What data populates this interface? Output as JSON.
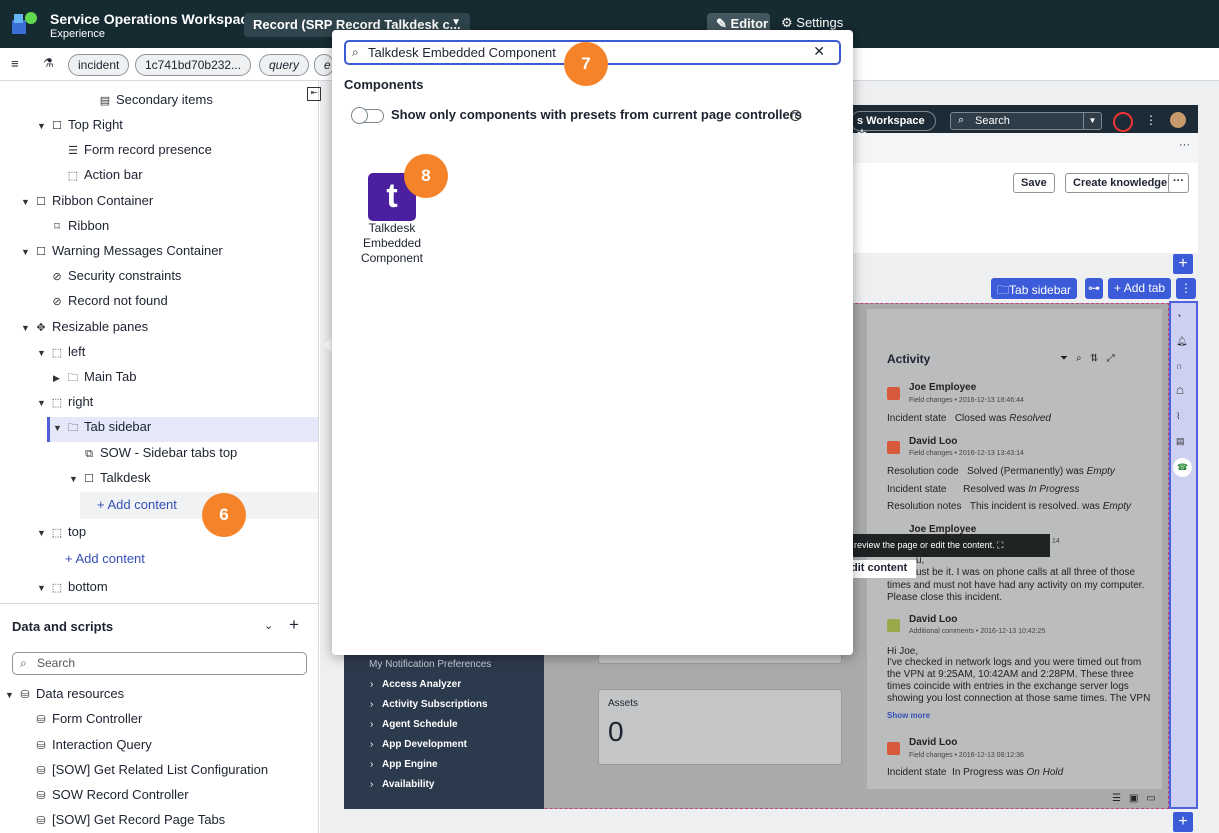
{
  "app": {
    "title": "Service Operations Workspace",
    "subtitle": "Experience"
  },
  "page_selector": {
    "label": "Record (SRP Record Talkdesk c...",
    "chevron": "chevron-down"
  },
  "mode": {
    "editor_label": "Editor",
    "settings_label": "Settings"
  },
  "filter_chips": [
    "incident",
    "1c741bd70b232...",
    "query",
    "e"
  ],
  "tree": {
    "secondary_items": "Secondary items",
    "top_right": "Top Right",
    "form_record_presence": "Form record presence",
    "action_bar": "Action bar",
    "ribbon_container": "Ribbon Container",
    "ribbon": "Ribbon",
    "warning_container": "Warning Messages Container",
    "security_constraints": "Security constraints",
    "record_not_found": "Record not found",
    "resizable_panes": "Resizable panes",
    "left": "left",
    "main_tab": "Main Tab",
    "right": "right",
    "tab_sidebar": "Tab sidebar",
    "sow_sidebar_tabs": "SOW - Sidebar tabs top",
    "talkdesk": "Talkdesk",
    "add_content_1": "Add content",
    "top": "top",
    "add_content_2": "Add content",
    "bottom": "bottom"
  },
  "data_scripts": {
    "title": "Data and scripts",
    "search_placeholder": "Search",
    "data_resources": "Data resources",
    "items": [
      "Form Controller",
      "Interaction Query",
      "[SOW] Get Related List Configuration",
      "SOW Record Controller",
      "[SOW] Get Record Page Tabs"
    ]
  },
  "modal": {
    "search_value": "Talkdesk Embedded Component",
    "section_title": "Components",
    "toggle_label": "Show only components with presets from current page controllers",
    "toggle_on": false,
    "tile_glyph": "t",
    "tile_label_lines": [
      "Talkdesk",
      "Embedded",
      "Component"
    ]
  },
  "step_badges": {
    "b6": "6",
    "b7": "7",
    "b8": "8"
  },
  "preview": {
    "workspace_pill": "s Workspace",
    "search_placeholder": "Search",
    "save": "Save",
    "create_knowledge": "Create knowledge",
    "tab_sidebar_btn": "Tab sidebar",
    "add_tab_btn": "Add tab",
    "activity_title": "Activity",
    "tooltip": "review the page or edit the content.",
    "edit_content": "dit content",
    "assets_label": "Assets",
    "assets_value": "0",
    "nav_pref": "My Notification Preferences",
    "nav_items": [
      "Access Analyzer",
      "Activity Subscriptions",
      "Agent Schedule",
      "App Development",
      "App Engine",
      "Availability"
    ],
    "activity_entries": [
      {
        "name": "Joe Employee",
        "meta": "Field changes • 2016-12-13 18:46:44",
        "lines": [
          [
            "Incident state",
            "Closed was ",
            "Resolved"
          ]
        ]
      },
      {
        "name": "David Loo",
        "meta": "Field changes • 2016-12-13 13:43:14",
        "lines": [
          [
            "Resolution code",
            "Solved (Permanently) was ",
            "Empty"
          ],
          [
            "Incident state",
            "Resolved was ",
            "In Progress"
          ],
          [
            "Resolution notes",
            "This incident is resolved. was ",
            "Empty"
          ]
        ]
      }
    ],
    "joe_partial": "Joe Employee",
    "joe_partial_time": "14",
    "joe_comment_1": "ust be it. I was on phone calls at all three of those",
    "joe_comment_2": "times and must not have had any activity on my computer.",
    "joe_comment_3": "Please close this incident.",
    "joe_comment_0": "u,",
    "david2_name": "David Loo",
    "david2_meta": "Additional comments • 2016-12-13 10:42:25",
    "david2_lines": [
      "Hi Joe,",
      "I've checked in network logs and you were timed out from",
      "the VPN at 9:25AM, 10:42AM and 2:28PM. These three",
      "times coincide with entries in the exchange server logs",
      "showing you lost connection at those same times. The VPN"
    ],
    "show_more": "Show more",
    "david3_name": "David Loo",
    "david3_meta": "Field changes • 2016-12-13 08:12:36",
    "david3_line": [
      "Incident state",
      "In Progress was ",
      "On Hold"
    ]
  },
  "colors": {
    "brand_dark": "#162a32",
    "accent": "#3c5bd8",
    "badge_orange": "#f5832a",
    "talkdesk_purple": "#4a1fa0"
  }
}
